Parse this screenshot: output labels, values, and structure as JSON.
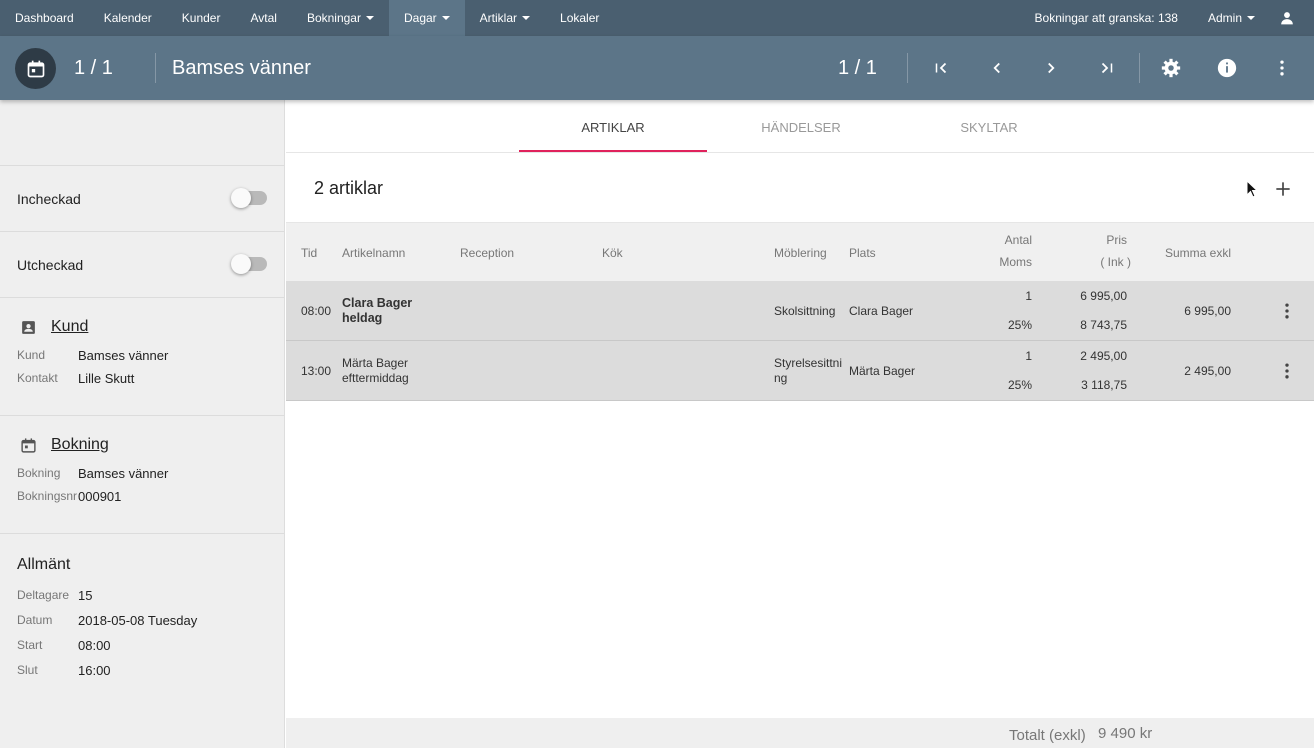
{
  "topnav": {
    "items": [
      {
        "label": "Dashboard",
        "dropdown": false
      },
      {
        "label": "Kalender",
        "dropdown": false
      },
      {
        "label": "Kunder",
        "dropdown": false
      },
      {
        "label": "Avtal",
        "dropdown": false
      },
      {
        "label": "Bokningar",
        "dropdown": true
      },
      {
        "label": "Dagar",
        "dropdown": true,
        "active": true
      },
      {
        "label": "Artiklar",
        "dropdown": true
      },
      {
        "label": "Lokaler",
        "dropdown": false
      }
    ],
    "review": "Bokningar att granska: 138",
    "user": "Admin"
  },
  "header": {
    "count_left": "1 / 1",
    "title": "Bamses vänner",
    "count_right": "1 / 1"
  },
  "sidebar": {
    "toggles": [
      {
        "label": "Incheckad",
        "on": false
      },
      {
        "label": "Utcheckad",
        "on": false
      }
    ],
    "kund": {
      "heading": "Kund",
      "rows": [
        {
          "key": "Kund",
          "value": "Bamses vänner"
        },
        {
          "key": "Kontakt",
          "value": "Lille Skutt"
        }
      ]
    },
    "bokning": {
      "heading": "Bokning",
      "rows": [
        {
          "key": "Bokning",
          "value": "Bamses vänner"
        },
        {
          "key": "Bokningsnr",
          "value": "000901"
        }
      ]
    },
    "allmant": {
      "heading": "Allmänt",
      "rows": [
        {
          "key": "Deltagare",
          "value": "15"
        },
        {
          "key": "Datum",
          "value": "2018-05-08 Tuesday"
        },
        {
          "key": "Start",
          "value": "08:00"
        },
        {
          "key": "Slut",
          "value": "16:00"
        }
      ]
    }
  },
  "tabs": [
    "ARTIKLAR",
    "HÄNDELSER",
    "SKYLTAR"
  ],
  "main": {
    "count_label": "2 artiklar"
  },
  "table": {
    "headers": {
      "tid": "Tid",
      "artikelnamn": "Artikelnamn",
      "reception": "Reception",
      "kok": "Kök",
      "moblering": "Möblering",
      "plats": "Plats",
      "antal": "Antal",
      "moms": "Moms",
      "pris": "Pris",
      "ink": "( Ink )",
      "summa": "Summa exkl"
    },
    "rows": [
      {
        "tid": "08:00",
        "name": "Clara Bager heldag",
        "bold": true,
        "moblering": "Skolsittning",
        "plats": "Clara Bager",
        "antal": "1",
        "moms": "25%",
        "pris": "6 995,00",
        "pris_ink": "8 743,75",
        "summa": "6 995,00"
      },
      {
        "tid": "13:00",
        "name": "Märta Bager efttermiddag",
        "bold": false,
        "moblering": "Styrelsesittning",
        "plats": "Märta Bager",
        "antal": "1",
        "moms": "25%",
        "pris": "2 495,00",
        "pris_ink": "3 118,75",
        "summa": "2 495,00"
      }
    ]
  },
  "footer": {
    "label": "Totalt (exkl)",
    "value": "9 490 kr"
  },
  "colors": {
    "topnav": "#4a5f70",
    "header": "#5c7588",
    "accent": "#e0225c"
  }
}
